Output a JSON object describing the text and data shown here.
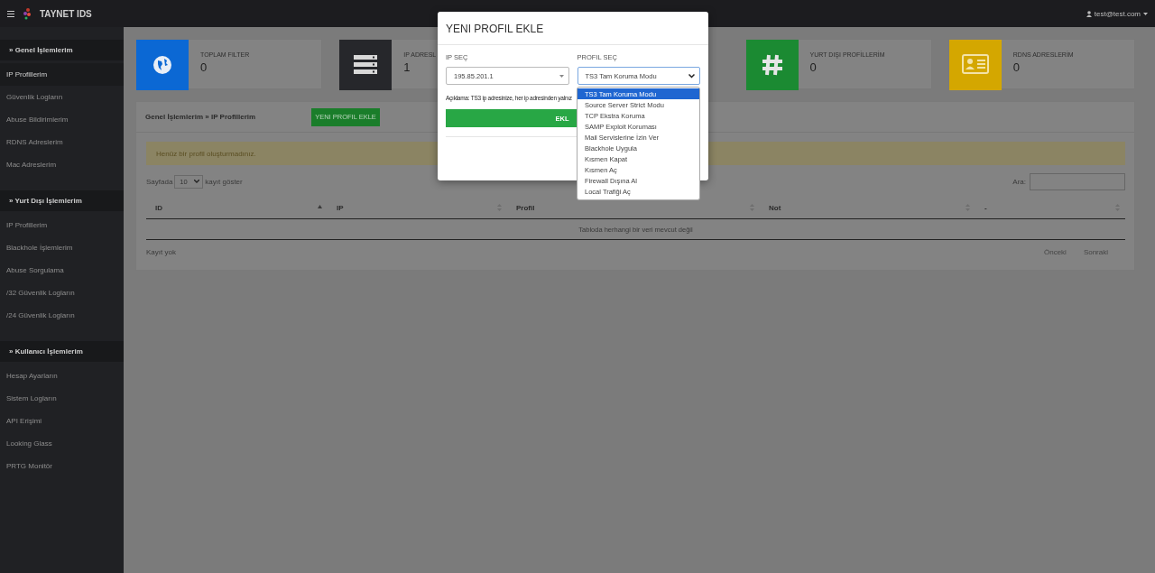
{
  "topbar": {
    "brand": "TAYNET IDS",
    "user": "test@test.com"
  },
  "sidebar": {
    "sections": [
      {
        "title": "» Genel İşlemlerim",
        "items": [
          {
            "label": "IP Profillerim",
            "selected": true
          },
          {
            "label": "Güvenlik Logların",
            "selected": false
          },
          {
            "label": "Abuse Bildirimlerim",
            "selected": false
          },
          {
            "label": "RDNS Adreslerim",
            "selected": false
          },
          {
            "label": "Mac Adreslerim",
            "selected": false
          }
        ]
      },
      {
        "title": "» Yurt Dışı İşlemlerim",
        "items": [
          {
            "label": "IP Profillerim",
            "selected": false
          },
          {
            "label": "Blackhole İşlemlerim",
            "selected": false
          },
          {
            "label": "Abuse Sorgulama",
            "selected": false
          },
          {
            "label": "/32 Güvenlik Logların",
            "selected": false
          },
          {
            "label": "/24 Güvenlik Logların",
            "selected": false
          }
        ]
      },
      {
        "title": "» Kullanıcı İşlemlerim",
        "items": [
          {
            "label": "Hesap Ayarların",
            "selected": false
          },
          {
            "label": "Sistem Logların",
            "selected": false
          },
          {
            "label": "API Erişimi",
            "selected": false
          },
          {
            "label": "Looking Glass",
            "selected": false
          },
          {
            "label": "PRTG Monitör",
            "selected": false
          }
        ]
      }
    ]
  },
  "stats": [
    {
      "label": "TOPLAM FILTER",
      "value": "0",
      "color": "#0b68d4",
      "kind": "globe"
    },
    {
      "label": "IP ADRESL",
      "value": "1",
      "color": "#26272b",
      "kind": "server"
    },
    {
      "label": "YURT DIŞI PROFİLLERİM",
      "value": "0",
      "color": "#1b8a32",
      "kind": "hash"
    },
    {
      "label": "RDNS ADRESLERİM",
      "value": "0",
      "color": "#d4a700",
      "kind": "card"
    }
  ],
  "panel": {
    "breadcrumb": "Genel İşlemlerim » IP Profillerim",
    "add_button": "YENI PROFIL EKLE",
    "alert": "Henüz bir profil oluşturmadınız.",
    "length": {
      "before": "Sayfada",
      "value": "10",
      "after": "kayıt göster"
    },
    "search_label": "Ara:",
    "columns": [
      {
        "label": "ID",
        "sorted": true
      },
      {
        "label": "IP",
        "sorted": false
      },
      {
        "label": "Profil",
        "sorted": false
      },
      {
        "label": "Not",
        "sorted": false
      },
      {
        "label": "-",
        "sorted": false
      }
    ],
    "empty": "Tabloda herhangi bir veri mevcut değil",
    "info": "Kayıt yok",
    "prev": "Önceki",
    "next": "Sonraki"
  },
  "modal": {
    "title": "YENI PROFIL EKLE",
    "ip_label": "IP SEÇ",
    "ip_value": "195.85.201.1",
    "profile_label": "PROFIL SEÇ",
    "profile_value": "TS3 Tam Koruma Modu",
    "options": [
      {
        "label": "TS3 Tam Koruma Modu",
        "selected": true
      },
      {
        "label": "Source Server Strict Modu",
        "selected": false
      },
      {
        "label": "TCP Ekstra Koruma",
        "selected": false
      },
      {
        "label": "SAMP Exploit Koruması",
        "selected": false
      },
      {
        "label": "Mail Servislerine İzin Ver",
        "selected": false
      },
      {
        "label": "Blackhole Uygula",
        "selected": false
      },
      {
        "label": "Kısmen Kapat",
        "selected": false
      },
      {
        "label": "Kısmen Aç",
        "selected": false
      },
      {
        "label": "Firewall Dışına Al",
        "selected": false
      },
      {
        "label": "Local Trafiği Aç",
        "selected": false
      }
    ],
    "note": "Açıklama: TS3 ip adresinize, her ip adresinden yalnız",
    "submit": "EKL"
  }
}
